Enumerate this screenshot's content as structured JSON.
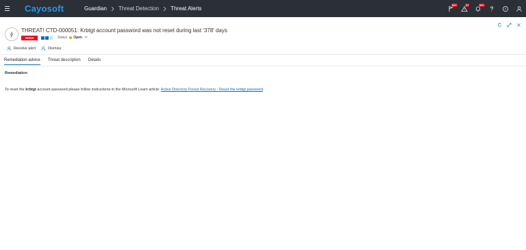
{
  "app": {
    "brand": "Cayosoft",
    "breadcrumb": [
      "Guardian",
      "Threat Detection",
      "Threat Alerts"
    ]
  },
  "topbar_icons": [
    {
      "name": "flag-icon",
      "badge": "99+"
    },
    {
      "name": "warning-icon",
      "badge": "37"
    },
    {
      "name": "bell-icon",
      "badge": "99+"
    },
    {
      "name": "help-icon",
      "badge": ""
    },
    {
      "name": "info-icon",
      "badge": ""
    },
    {
      "name": "user-icon",
      "badge": ""
    }
  ],
  "alert": {
    "title": "THREAT! CTD-000051: Krbtgt account password was not reset during last '378' days",
    "severity": "HIGH",
    "severity_color": "#e81123",
    "status_label": "Status",
    "status_value": "Open",
    "status_color": "#e8a01b"
  },
  "actions": {
    "resolve": "Resolve alert",
    "dismiss": "Dismiss"
  },
  "tabs": [
    {
      "label": "Remediation advice",
      "active": true
    },
    {
      "label": "Threat description",
      "active": false
    },
    {
      "label": "Details",
      "active": false
    }
  ],
  "remediation": {
    "section_title": "Remediation",
    "text_before": "To reset the ",
    "bold": "krbtgt",
    "text_after": " account password please follow instructions in the Microsoft Learn article: ",
    "link_text": "Active Directory Forest Recovery - Reset the krbtgt password",
    "end": "."
  }
}
